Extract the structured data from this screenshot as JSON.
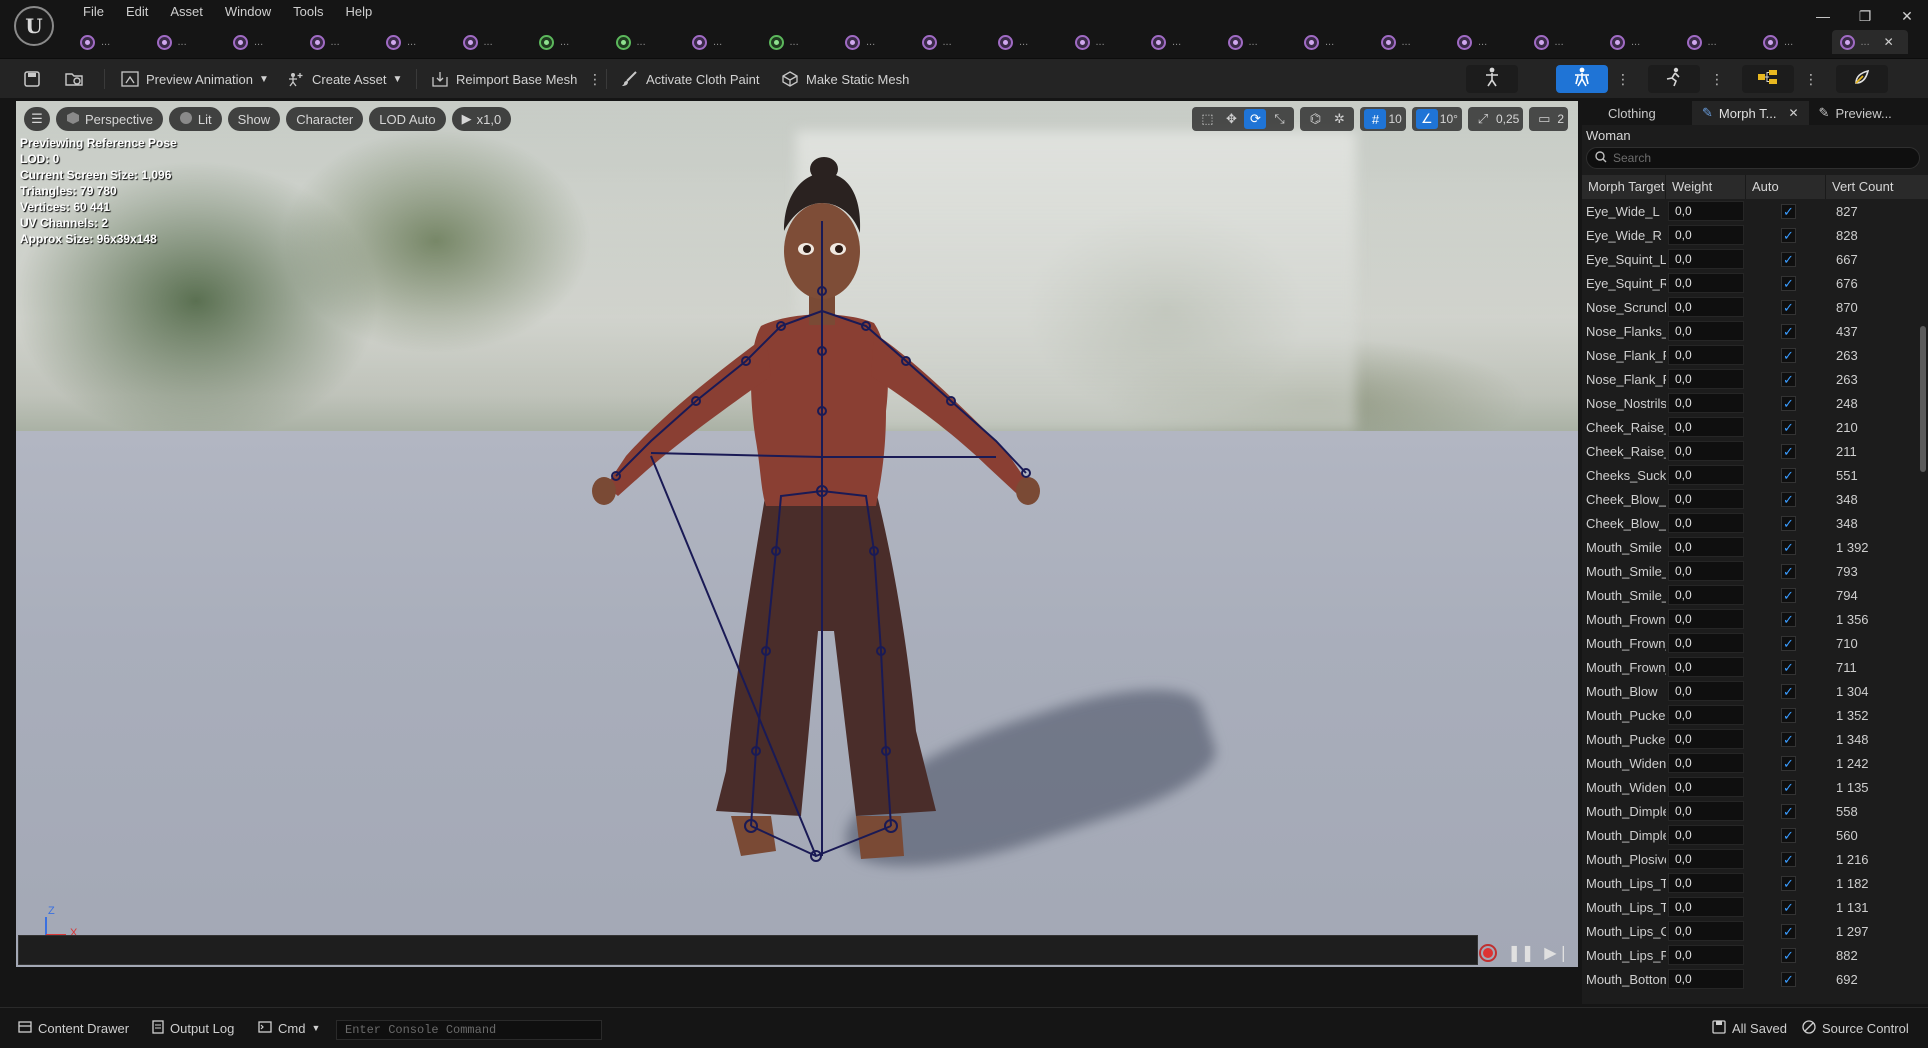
{
  "menu": {
    "items": [
      "File",
      "Edit",
      "Asset",
      "Window",
      "Tools",
      "Help"
    ],
    "window_controls": [
      "—",
      "❐",
      "✕"
    ]
  },
  "asset_tabs": [
    {
      "kind": "skeletal",
      "label": "..."
    },
    {
      "kind": "skeletal",
      "label": "..."
    },
    {
      "kind": "skeletal",
      "label": "..."
    },
    {
      "kind": "skeletal",
      "label": "..."
    },
    {
      "kind": "skeletal",
      "label": "..."
    },
    {
      "kind": "skeletal",
      "label": "..."
    },
    {
      "kind": "green",
      "label": "..."
    },
    {
      "kind": "green",
      "label": "..."
    },
    {
      "kind": "skeletal",
      "label": "..."
    },
    {
      "kind": "green",
      "label": "..."
    },
    {
      "kind": "skeletal",
      "label": "..."
    },
    {
      "kind": "skeletal",
      "label": "..."
    },
    {
      "kind": "skeletal",
      "label": "..."
    },
    {
      "kind": "skeletal",
      "label": "..."
    },
    {
      "kind": "skeletal",
      "label": "..."
    },
    {
      "kind": "skeletal",
      "label": "..."
    },
    {
      "kind": "skeletal",
      "label": "..."
    },
    {
      "kind": "skeletal",
      "label": "..."
    },
    {
      "kind": "skeletal",
      "label": "..."
    },
    {
      "kind": "skeletal",
      "label": "..."
    },
    {
      "kind": "skeletal",
      "label": "..."
    },
    {
      "kind": "skeletal",
      "label": "..."
    },
    {
      "kind": "skeletal",
      "label": "..."
    },
    {
      "kind": "skeletal",
      "label": "...",
      "active": true,
      "close": "✕"
    }
  ],
  "toolbar": {
    "preview_animation": "Preview Animation",
    "create_asset": "Create Asset",
    "reimport_base_mesh": "Reimport Base Mesh",
    "activate_cloth_paint": "Activate Cloth Paint",
    "make_static_mesh": "Make Static Mesh"
  },
  "viewport": {
    "perspective": "Perspective",
    "lit": "Lit",
    "show": "Show",
    "character": "Character",
    "lod": "LOD Auto",
    "play_speed": "x1,0",
    "grid_size": "10",
    "rotation_snap": "10°",
    "scale_snap": "0,25",
    "camera_speed": "2",
    "stats": [
      "Previewing Reference Pose",
      "LOD: 0",
      "Current Screen Size: 1,096",
      "Triangles: 79 780",
      "Vertices: 60 441",
      "UV Channels: 2",
      "Approx Size: 96x39x148"
    ],
    "axis_z": "Z",
    "axis_x": "X"
  },
  "panel": {
    "tabs": {
      "clothing": "Clothing",
      "morph": "Morph T...",
      "preview": "Preview...",
      "close": "✕"
    },
    "mesh_name": "Woman",
    "search_placeholder": "Search",
    "columns": {
      "name": "Morph Target",
      "weight": "Weight",
      "auto": "Auto",
      "count": "Vert Count"
    },
    "rows": [
      {
        "name": "Eye_Wide_L",
        "weight": "0,0",
        "auto": true,
        "count": "827"
      },
      {
        "name": "Eye_Wide_R",
        "weight": "0,0",
        "auto": true,
        "count": "828"
      },
      {
        "name": "Eye_Squint_L",
        "weight": "0,0",
        "auto": true,
        "count": "667"
      },
      {
        "name": "Eye_Squint_R",
        "weight": "0,0",
        "auto": true,
        "count": "676"
      },
      {
        "name": "Nose_Scrunch",
        "weight": "0,0",
        "auto": true,
        "count": "870"
      },
      {
        "name": "Nose_Flanks_",
        "weight": "0,0",
        "auto": true,
        "count": "437"
      },
      {
        "name": "Nose_Flank_R",
        "weight": "0,0",
        "auto": true,
        "count": "263"
      },
      {
        "name": "Nose_Flank_R",
        "weight": "0,0",
        "auto": true,
        "count": "263"
      },
      {
        "name": "Nose_Nostrils",
        "weight": "0,0",
        "auto": true,
        "count": "248"
      },
      {
        "name": "Cheek_Raise_",
        "weight": "0,0",
        "auto": true,
        "count": "210"
      },
      {
        "name": "Cheek_Raise_",
        "weight": "0,0",
        "auto": true,
        "count": "211"
      },
      {
        "name": "Cheeks_Suck",
        "weight": "0,0",
        "auto": true,
        "count": "551"
      },
      {
        "name": "Cheek_Blow_L",
        "weight": "0,0",
        "auto": true,
        "count": "348"
      },
      {
        "name": "Cheek_Blow_R",
        "weight": "0,0",
        "auto": true,
        "count": "348"
      },
      {
        "name": "Mouth_Smile",
        "weight": "0,0",
        "auto": true,
        "count": "1 392"
      },
      {
        "name": "Mouth_Smile_",
        "weight": "0,0",
        "auto": true,
        "count": "793"
      },
      {
        "name": "Mouth_Smile_",
        "weight": "0,0",
        "auto": true,
        "count": "794"
      },
      {
        "name": "Mouth_Frown",
        "weight": "0,0",
        "auto": true,
        "count": "1 356"
      },
      {
        "name": "Mouth_Frown_",
        "weight": "0,0",
        "auto": true,
        "count": "710"
      },
      {
        "name": "Mouth_Frown_",
        "weight": "0,0",
        "auto": true,
        "count": "711"
      },
      {
        "name": "Mouth_Blow",
        "weight": "0,0",
        "auto": true,
        "count": "1 304"
      },
      {
        "name": "Mouth_Pucker",
        "weight": "0,0",
        "auto": true,
        "count": "1 352"
      },
      {
        "name": "Mouth_Pucker",
        "weight": "0,0",
        "auto": true,
        "count": "1 348"
      },
      {
        "name": "Mouth_Widen",
        "weight": "0,0",
        "auto": true,
        "count": "1 242"
      },
      {
        "name": "Mouth_Widen_",
        "weight": "0,0",
        "auto": true,
        "count": "1 135"
      },
      {
        "name": "Mouth_Dimple",
        "weight": "0,0",
        "auto": true,
        "count": "558"
      },
      {
        "name": "Mouth_Dimple",
        "weight": "0,0",
        "auto": true,
        "count": "560"
      },
      {
        "name": "Mouth_Plosive",
        "weight": "0,0",
        "auto": true,
        "count": "1 216"
      },
      {
        "name": "Mouth_Lips_T",
        "weight": "0,0",
        "auto": true,
        "count": "1 182"
      },
      {
        "name": "Mouth_Lips_T",
        "weight": "0,0",
        "auto": true,
        "count": "1 131"
      },
      {
        "name": "Mouth_Lips_O",
        "weight": "0,0",
        "auto": true,
        "count": "1 297"
      },
      {
        "name": "Mouth_Lips_P",
        "weight": "0,0",
        "auto": true,
        "count": "882"
      },
      {
        "name": "Mouth_Bottom",
        "weight": "0,0",
        "auto": true,
        "count": "692"
      }
    ]
  },
  "statusbar": {
    "content_drawer": "Content Drawer",
    "output_log": "Output Log",
    "cmd": "Cmd",
    "console_placeholder": "Enter Console Command",
    "all_saved": "All Saved",
    "source_control": "Source Control"
  },
  "colors": {
    "accent_blue": "#1f74d6",
    "checkbox_blue": "#3a9cff",
    "record_red": "#d33333",
    "skeleton_navy": "#1a1a55"
  }
}
